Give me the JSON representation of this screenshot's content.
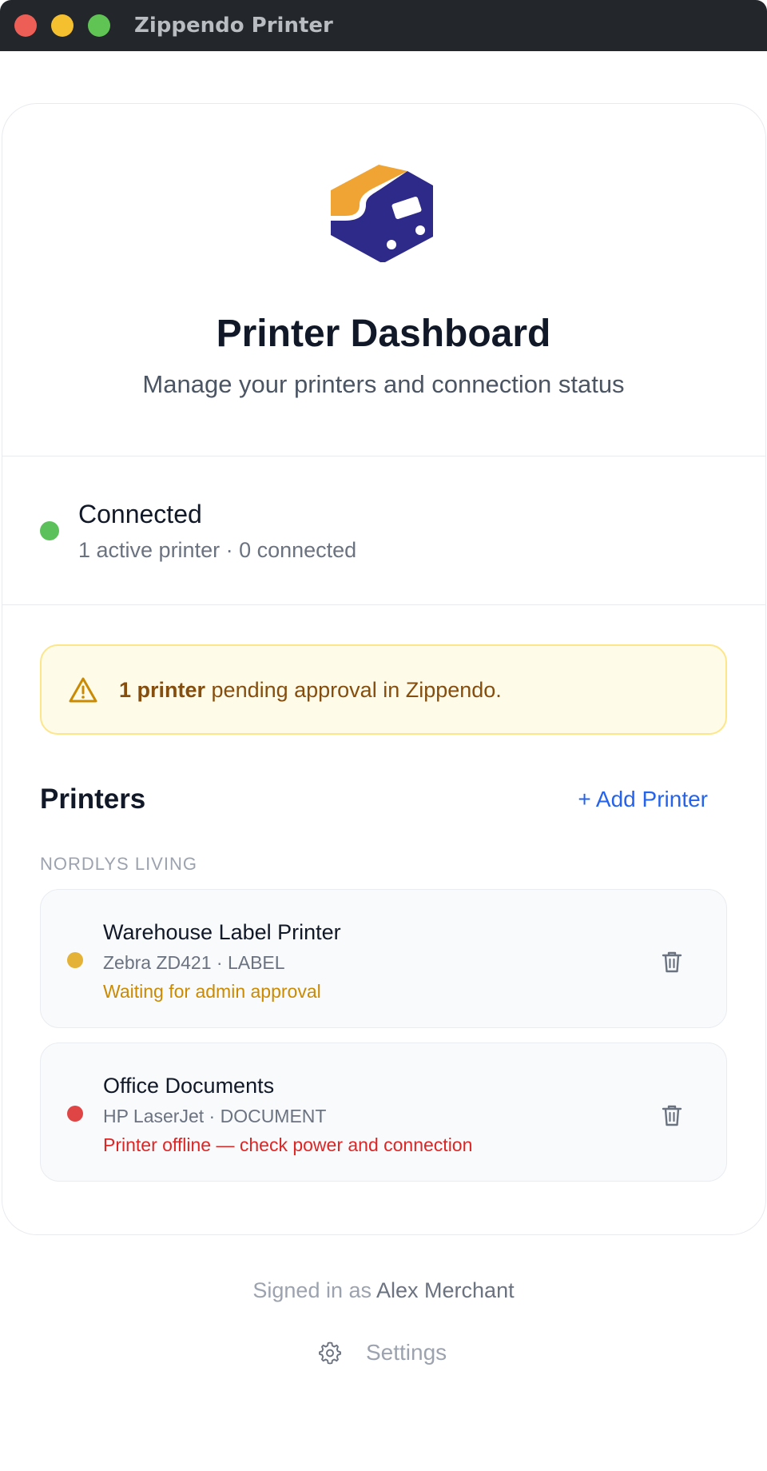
{
  "window": {
    "title": "Zippendo Printer"
  },
  "header": {
    "logo_icon": "printer-cube-logo",
    "title": "Printer Dashboard",
    "subtitle": "Manage your printers and connection status"
  },
  "connection": {
    "status": "Connected",
    "details": "1 active printer · 0 connected",
    "color": "#5cc15b"
  },
  "alert": {
    "icon": "warning-triangle-icon",
    "count_text": "1 printer",
    "message": " pending approval in Zippendo."
  },
  "printers_section": {
    "title": "Printers",
    "add_label": "+ Add Printer",
    "group_label": "NORDLYS LIVING",
    "items": [
      {
        "name": "Warehouse Label Printer",
        "meta": "Zebra ZD421 · LABEL",
        "status": "Waiting for admin approval",
        "status_color": "#ca8a04",
        "dot_color": "#e3b236"
      },
      {
        "name": "Office Documents",
        "meta": "HP LaserJet · DOCUMENT",
        "status": "Printer offline — check power and connection",
        "status_color": "#dc2626",
        "dot_color": "#e04545"
      }
    ]
  },
  "footer": {
    "signed_in_prefix": "Signed in as ",
    "user_name": "Alex Merchant",
    "settings_label": "Settings"
  },
  "colors": {
    "accent_blue": "#2563eb",
    "logo_orange": "#f0a434",
    "logo_indigo": "#2e2a8a",
    "titlebar": "#23262b"
  }
}
